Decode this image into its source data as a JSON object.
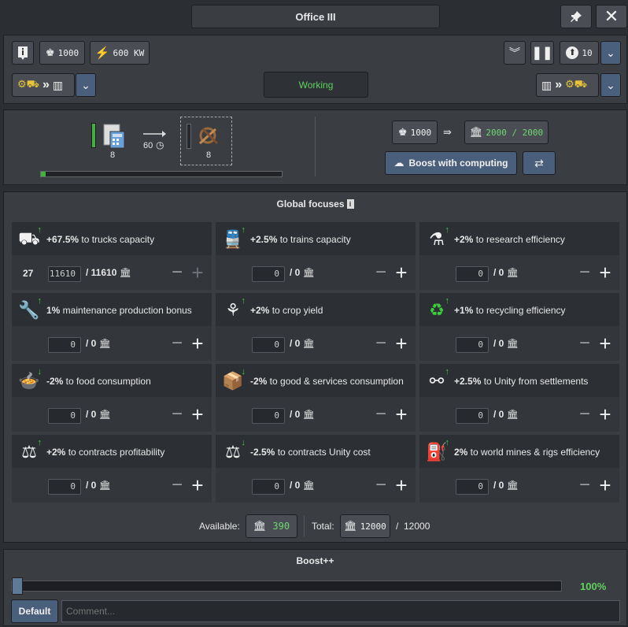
{
  "window": {
    "title": "Office III"
  },
  "header": {
    "workers": "1000",
    "power": "600 KW",
    "upgrade_level": "10",
    "status": "Working",
    "input_label": "»",
    "output_label": "»"
  },
  "production": {
    "input_count": "8",
    "duration": "60",
    "output_count": "8",
    "computing_from": "1000",
    "computing_to": "2000 / 2000",
    "boost_label": "Boost with computing"
  },
  "focuses": {
    "title": "Global focuses",
    "info": "i",
    "items": [
      {
        "label": "+67.5% to trucks capacity",
        "bold": "+67.5%",
        "icon": "truck-icon",
        "count": "27",
        "value": "11610",
        "max": "11610"
      },
      {
        "label": "+2.5% to trains capacity",
        "bold": "+2.5%",
        "icon": "train-icon",
        "value": "0",
        "max": "0"
      },
      {
        "label": "+2% to research efficiency",
        "bold": "+2%",
        "icon": "flask-icon",
        "value": "0",
        "max": "0"
      },
      {
        "label": "1% maintenance production bonus",
        "bold": "1%",
        "icon": "wrench-icon",
        "value": "0",
        "max": "0"
      },
      {
        "label": "+2% to crop yield",
        "bold": "+2%",
        "icon": "wheat-icon",
        "value": "0",
        "max": "0"
      },
      {
        "label": "+1% to recycling efficiency",
        "bold": "+1%",
        "icon": "recycle-icon",
        "value": "0",
        "max": "0"
      },
      {
        "label": "-2% to food consumption",
        "bold": "-2%",
        "icon": "food-bowl-icon",
        "value": "0",
        "max": "0"
      },
      {
        "label": "-2% to good & services consumption",
        "bold": "-2%",
        "icon": "goods-icon",
        "value": "0",
        "max": "0"
      },
      {
        "label": "+2.5% to Unity from settlements",
        "bold": "+2.5%",
        "icon": "unity-icon",
        "value": "0",
        "max": "0"
      },
      {
        "label": "+2% to contracts profitability",
        "bold": "+2%",
        "icon": "scales-icon",
        "value": "0",
        "max": "0"
      },
      {
        "label": "-2.5% to contracts Unity cost",
        "bold": "-2.5%",
        "icon": "scales-unity-icon",
        "value": "0",
        "max": "0"
      },
      {
        "label": "2% to world mines & rigs efficiency",
        "bold": "2%",
        "icon": "oil-rig-icon",
        "value": "0",
        "max": "0"
      }
    ],
    "available_label": "Available:",
    "available_value": "390",
    "total_label": "Total:",
    "total_value": "12000",
    "total_max": "12000"
  },
  "boost": {
    "title": "Boost++",
    "percent": "100%",
    "default_label": "Default",
    "comment_placeholder": "Comment..."
  },
  "colors": {
    "accent_green": "#6fd86f",
    "status_green": "#5fd35f",
    "boost_blue": "#4a5f7c"
  }
}
